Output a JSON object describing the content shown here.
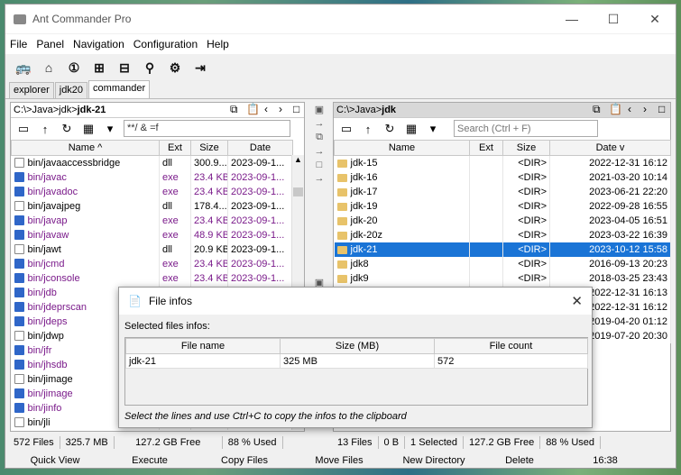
{
  "window": {
    "title": "Ant Commander Pro",
    "min_icon": "minimize-icon",
    "max_icon": "maximize-icon",
    "close_icon": "close-icon"
  },
  "menu": [
    "File",
    "Panel",
    "Navigation",
    "Configuration",
    "Help"
  ],
  "toolbar": [
    "bus-icon",
    "home-icon",
    "one-icon",
    "plus-icon",
    "minus-icon",
    "zoom-icon",
    "gear-icon",
    "exit-icon"
  ],
  "tabs": [
    {
      "label": "explorer"
    },
    {
      "label": "jdk20"
    },
    {
      "label": "commander",
      "active": true
    }
  ],
  "left": {
    "path_prefix": "C:\\>Java>jdk>",
    "path_current": "jdk-21",
    "filter": "**/ & =f",
    "cols": {
      "name": "Name ^",
      "ext": "Ext",
      "size": "Size",
      "date": "Date"
    },
    "rows": [
      {
        "name": "bin/javaaccessbridge",
        "ext": "dll",
        "size": "300.9...",
        "date": "2023-09-1...",
        "type": "plain"
      },
      {
        "name": "bin/javac",
        "ext": "exe",
        "size": "23.4 KB",
        "date": "2023-09-1...",
        "type": "exe"
      },
      {
        "name": "bin/javadoc",
        "ext": "exe",
        "size": "23.4 KB",
        "date": "2023-09-1...",
        "type": "exe"
      },
      {
        "name": "bin/javajpeg",
        "ext": "dll",
        "size": "178.4...",
        "date": "2023-09-1...",
        "type": "plain"
      },
      {
        "name": "bin/javap",
        "ext": "exe",
        "size": "23.4 KB",
        "date": "2023-09-1...",
        "type": "exe"
      },
      {
        "name": "bin/javaw",
        "ext": "exe",
        "size": "48.9 KB",
        "date": "2023-09-1...",
        "type": "exe"
      },
      {
        "name": "bin/jawt",
        "ext": "dll",
        "size": "20.9 KB",
        "date": "2023-09-1...",
        "type": "plain"
      },
      {
        "name": "bin/jcmd",
        "ext": "exe",
        "size": "23.4 KB",
        "date": "2023-09-1...",
        "type": "exe"
      },
      {
        "name": "bin/jconsole",
        "ext": "exe",
        "size": "23.4 KB",
        "date": "2023-09-1...",
        "type": "exe"
      },
      {
        "name": "bin/jdb",
        "ext": "",
        "size": "",
        "date": "",
        "type": "exe"
      },
      {
        "name": "bin/jdeprscan",
        "ext": "",
        "size": "",
        "date": "",
        "type": "exe"
      },
      {
        "name": "bin/jdeps",
        "ext": "",
        "size": "",
        "date": "",
        "type": "exe"
      },
      {
        "name": "bin/jdwp",
        "ext": "",
        "size": "",
        "date": "",
        "type": "plain"
      },
      {
        "name": "bin/jfr",
        "ext": "",
        "size": "",
        "date": "",
        "type": "exe"
      },
      {
        "name": "bin/jhsdb",
        "ext": "",
        "size": "",
        "date": "",
        "type": "exe"
      },
      {
        "name": "bin/jimage",
        "ext": "",
        "size": "",
        "date": "",
        "type": "plain"
      },
      {
        "name": "bin/jimage",
        "ext": "",
        "size": "",
        "date": "",
        "type": "exe"
      },
      {
        "name": "bin/jinfo",
        "ext": "",
        "size": "",
        "date": "",
        "type": "exe"
      },
      {
        "name": "bin/jli",
        "ext": "",
        "size": "",
        "date": "",
        "type": "plain"
      }
    ],
    "status": [
      "572 Files",
      "325.7 MB",
      "127.2 GB Free",
      "88 % Used"
    ]
  },
  "right": {
    "path_prefix": "C:\\>Java>",
    "path_current": "jdk",
    "search_placeholder": "Search (Ctrl + F)",
    "cols": {
      "name": "Name",
      "ext": "Ext",
      "size": "Size",
      "date": "Date v"
    },
    "rows": [
      {
        "name": "jdk-15",
        "size": "<DIR>",
        "date": "2022-12-31 16:12"
      },
      {
        "name": "jdk-16",
        "size": "<DIR>",
        "date": "2021-03-20 10:14"
      },
      {
        "name": "jdk-17",
        "size": "<DIR>",
        "date": "2023-06-21 22:20"
      },
      {
        "name": "jdk-19",
        "size": "<DIR>",
        "date": "2022-09-28 16:55"
      },
      {
        "name": "jdk-20",
        "size": "<DIR>",
        "date": "2023-04-05 16:51"
      },
      {
        "name": "jdk-20z",
        "size": "<DIR>",
        "date": "2023-03-22 16:39"
      },
      {
        "name": "jdk-21",
        "size": "<DIR>",
        "date": "2023-10-12 15:58",
        "selected": true
      },
      {
        "name": "jdk8",
        "size": "<DIR>",
        "date": "2016-09-13 20:23"
      },
      {
        "name": "jdk9",
        "size": "<DIR>",
        "date": "2018-03-25 23:43"
      },
      {
        "name": "",
        "size": "",
        "date": "2022-12-31 16:13"
      },
      {
        "name": "",
        "size": "",
        "date": "2022-12-31 16:12"
      },
      {
        "name": "",
        "size": "",
        "date": "2019-04-20 01:12"
      },
      {
        "name": "",
        "size": "",
        "date": "2019-07-20 20:30"
      }
    ],
    "status": [
      "13 Files",
      "0 B",
      "1 Selected",
      "127.2 GB Free",
      "88 % Used"
    ]
  },
  "fkeys": [
    "Quick View",
    "Execute",
    "Copy Files",
    "Move Files",
    "New Directory",
    "Delete",
    "16:38"
  ],
  "dialog": {
    "title": "File infos",
    "label": "Selected files infos:",
    "cols": [
      "File name",
      "Size (MB)",
      "File count"
    ],
    "row": [
      "jdk-21",
      "325 MB",
      "572"
    ],
    "footer": "Select the lines and use Ctrl+C to copy the infos to the clipboard"
  }
}
